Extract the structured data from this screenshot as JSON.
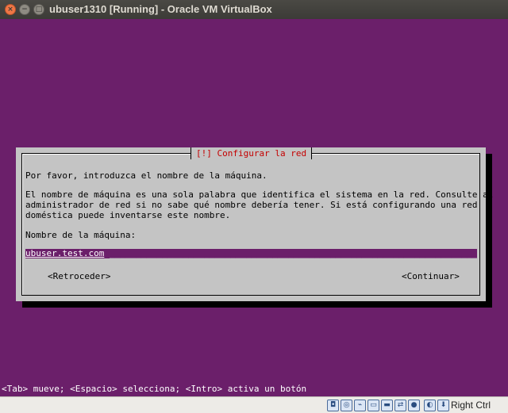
{
  "window": {
    "title": "ubuser1310 [Running] - Oracle VM VirtualBox",
    "close_glyph": "×",
    "min_glyph": "−",
    "max_glyph": "□"
  },
  "dialog": {
    "title": "[!] Configurar la red",
    "intro": "Por favor, introduzca el nombre de la máquina.",
    "desc_lines": [
      "El nombre de máquina es una sola palabra que identifica el sistema en la red. Consulte al",
      "administrador de red si no sabe qué nombre debería tener. Si está configurando una red",
      "doméstica puede inventarse este nombre."
    ],
    "field_label": "Nombre de la máquina:",
    "hostname_value": "ubuser.test.com",
    "back_button": "<Retroceder>",
    "continue_button": "<Continuar>"
  },
  "footer_hint": "<Tab> mueve; <Espacio> selecciona; <Intro> activa un botón",
  "statusbar": {
    "icons": [
      "hard-disk-icon",
      "optical-drive-icon",
      "usb-icon",
      "shared-folders-icon",
      "display-icon",
      "network-icon",
      "video-capture-icon",
      "mouse-integration-icon",
      "host-key-arrow-icon"
    ],
    "host_key": "Right Ctrl"
  },
  "colors": {
    "console_bg": "#6b1f6a",
    "dialog_bg": "#c4c4c4",
    "dialog_title": "#c40000",
    "titlebar_bg": "#3c3b37"
  }
}
